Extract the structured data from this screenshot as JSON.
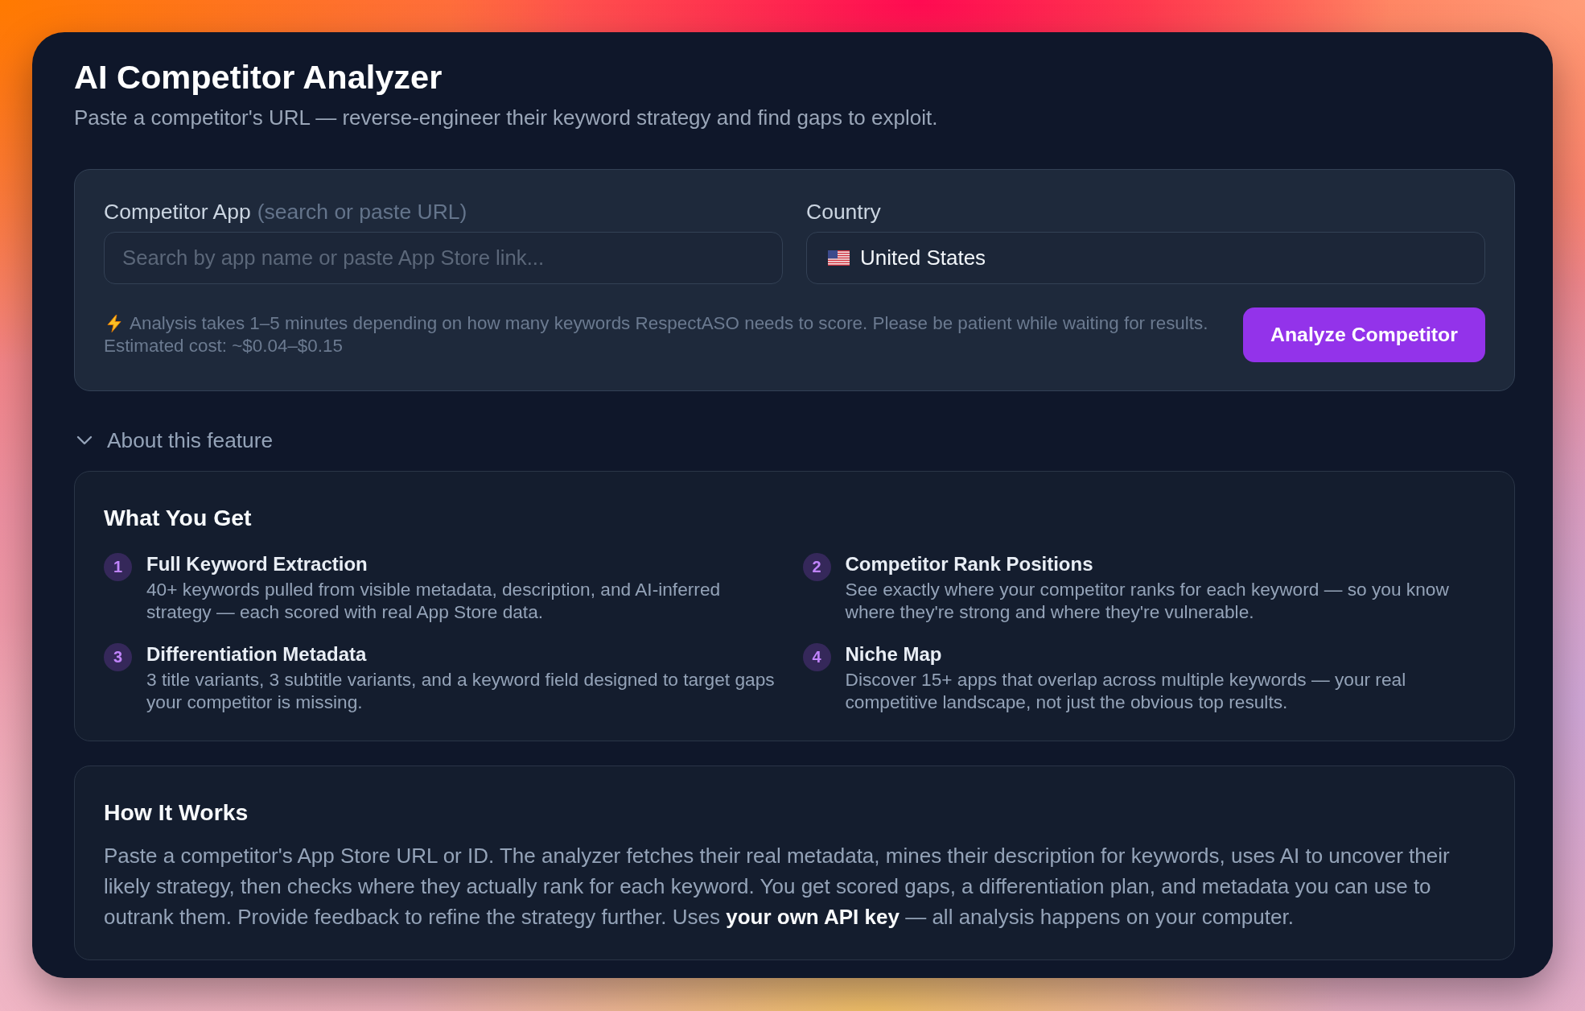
{
  "header": {
    "title": "AI Competitor Analyzer",
    "subtitle": "Paste a competitor's URL — reverse-engineer their keyword strategy and find gaps to exploit."
  },
  "form": {
    "app_field": {
      "label": "Competitor App",
      "hint": "(search or paste URL)",
      "placeholder": "Search by app name or paste App Store link..."
    },
    "country_field": {
      "label": "Country",
      "value": "United States"
    },
    "note": {
      "text": "Analysis takes 1–5 minutes depending on how many keywords RespectASO needs to score. Please be patient while waiting for results.",
      "cost": "Estimated cost: ~$0.04–$0.15"
    },
    "submit_button": "Analyze Competitor"
  },
  "about": {
    "label": "About this feature",
    "expanded": true,
    "what_you_get": {
      "heading": "What You Get",
      "items": [
        {
          "number": "1",
          "title": "Full Keyword Extraction",
          "description": "40+ keywords pulled from visible metadata, description, and AI-inferred strategy — each scored with real App Store data."
        },
        {
          "number": "2",
          "title": "Competitor Rank Positions",
          "description": "See exactly where your competitor ranks for each keyword — so you know where they're strong and where they're vulnerable."
        },
        {
          "number": "3",
          "title": "Differentiation Metadata",
          "description": "3 title variants, 3 subtitle variants, and a keyword field designed to target gaps your competitor is missing."
        },
        {
          "number": "4",
          "title": "Niche Map",
          "description": "Discover 15+ apps that overlap across multiple keywords — your real competitive landscape, not just the obvious top results."
        }
      ]
    },
    "how_it_works": {
      "heading": "How It Works",
      "text": "Paste a competitor's App Store URL or ID. The analyzer fetches their real metadata, mines their description for keywords, uses AI to uncover their likely strategy, then checks where they actually rank for each keyword. You get scored gaps, a differentiation plan, and metadata you can use to outrank them. Provide feedback to refine the strategy further. Uses **your own API key** — all analysis happens on your computer."
    }
  }
}
